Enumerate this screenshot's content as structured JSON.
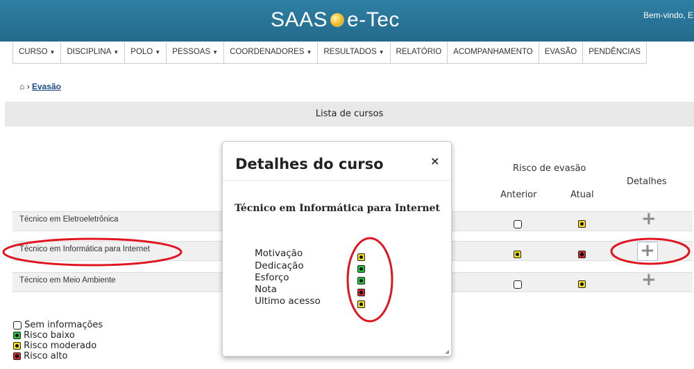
{
  "header": {
    "title_left": "SAAS",
    "title_right": "e-Tec",
    "welcome": "Bem-vindo, E"
  },
  "nav": [
    {
      "label": "CURSO",
      "caret": "▼"
    },
    {
      "label": "DISCIPLINA",
      "caret": "▼"
    },
    {
      "label": "POLO",
      "caret": "▼"
    },
    {
      "label": "PESSOAS",
      "caret": "▼"
    },
    {
      "label": "COORDENADORES",
      "caret": "▼"
    },
    {
      "label": "RESULTADOS",
      "caret": "▼"
    },
    {
      "label": "RELATÓRIO"
    },
    {
      "label": "ACOMPANHAMENTO"
    },
    {
      "label": "EVASÃO"
    },
    {
      "label": "PENDÊNCIAS"
    }
  ],
  "breadcrumb": {
    "home_icon": "⌂",
    "sep": "›",
    "current": "Evasão"
  },
  "list": {
    "title": "Lista de cursos",
    "headers": {
      "risk": "Risco de evasão",
      "previous": "Anterior",
      "current": "Atual",
      "details": "Detalhes"
    },
    "rows": [
      {
        "name": "Técnico em Eletroeletrônica",
        "previous": "empty",
        "current": "yellow"
      },
      {
        "name": "Técnico em Informática para Internet",
        "previous": "yellow",
        "current": "red"
      },
      {
        "name": "Técnico em Meio Ambiente",
        "previous": "empty",
        "current": "yellow"
      }
    ]
  },
  "legend": [
    {
      "icon": "empty",
      "label": "Sem informações"
    },
    {
      "icon": "green",
      "label": "Risco baixo"
    },
    {
      "icon": "yellow",
      "label": "Risco moderado"
    },
    {
      "icon": "red",
      "label": "Risco alto"
    }
  ],
  "modal": {
    "title": "Detalhes do curso",
    "close": "×",
    "course": "Técnico em Informática para Internet",
    "items": [
      {
        "label": "Motivação",
        "icon": "yellow"
      },
      {
        "label": "Dedicação",
        "icon": "green"
      },
      {
        "label": "Esforço",
        "icon": "green"
      },
      {
        "label": "Nota",
        "icon": "red"
      },
      {
        "label": "Ultimo acesso",
        "icon": "yellow"
      }
    ]
  },
  "colors": {
    "header": "#2e7fa3",
    "annotation": "#e0141e",
    "yellow": "#f4e01b",
    "green": "#28c23e",
    "red": "#d82b2b"
  },
  "icons": {
    "details": "plus-icon",
    "close": "close-icon",
    "home": "home-icon"
  }
}
